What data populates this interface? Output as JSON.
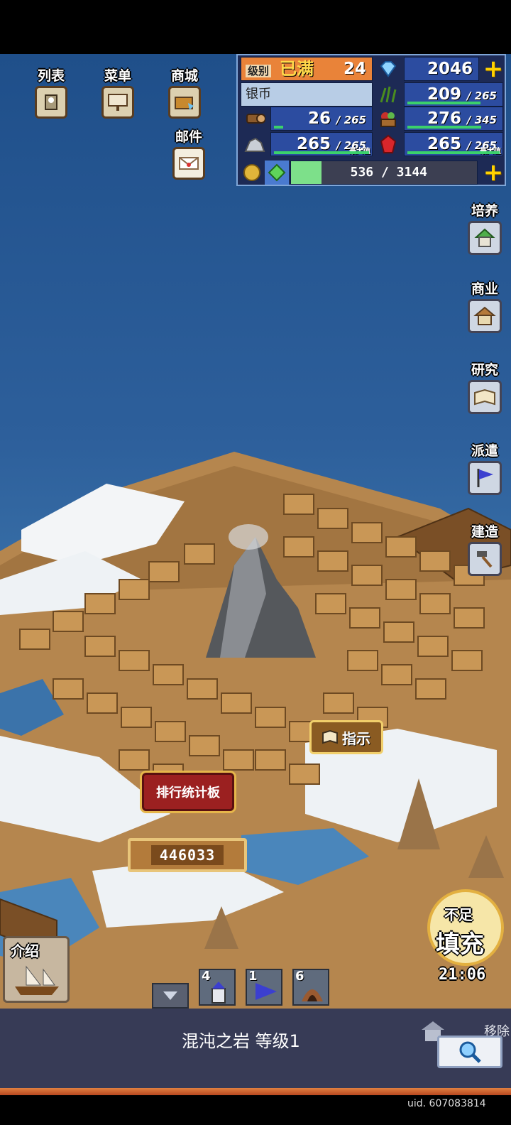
{
  "top_menu": {
    "list_label": "列表",
    "menu_label": "菜单",
    "shop_label": "商城",
    "mail_label": "邮件"
  },
  "resources": {
    "level_label": "级别",
    "level_status": "已满",
    "level_value": "24",
    "gems": "2046",
    "silver_label": "银币",
    "grass": {
      "current": "209",
      "max": "265",
      "fill": 0.79
    },
    "wood": {
      "current": "26",
      "max": "265",
      "fill": 0.1
    },
    "food": {
      "current": "276",
      "max": "345",
      "fill": 0.8
    },
    "ore": {
      "current": "265",
      "max": "265",
      "max_tag": "最大值",
      "fill": 1.0
    },
    "ruby": {
      "current": "265",
      "max": "265",
      "max_tag": "最大值",
      "fill": 1.0
    },
    "experience": {
      "current": "536",
      "max": "3144",
      "fill": 0.17
    },
    "plus": "+"
  },
  "side_menu": {
    "training": "培养",
    "commerce": "商业",
    "research": "研究",
    "dispatch": "派遣",
    "build": "建造"
  },
  "map": {
    "ranking_board": "排行统计板",
    "score": "446033",
    "guide_button": "指示",
    "intro_button": "介绍"
  },
  "fill_badge": {
    "top": "不足",
    "label": "填充",
    "timer": "21:06"
  },
  "unit_counts": {
    "castle": "4",
    "flag": "1",
    "cave": "6"
  },
  "selection": {
    "title": "混沌之岩 等级1",
    "move_label": "移除"
  },
  "footer": {
    "uid": "uid. 607083814"
  },
  "colors": {
    "sea": "#2d5f9b",
    "snow": "#f3f5f7",
    "ground": "#b5864e",
    "sign": "#c99756",
    "panel": "#2c4ca0"
  }
}
